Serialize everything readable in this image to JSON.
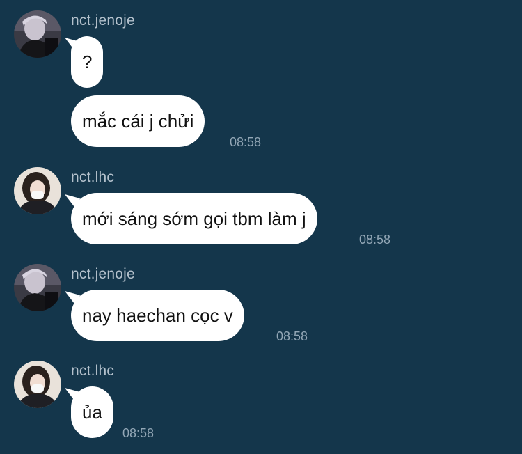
{
  "colors": {
    "background": "#14364b",
    "bubble": "#ffffff",
    "name_text": "#b4c1cc",
    "time_text": "#93a7b6"
  },
  "messages": [
    {
      "sender": "nct.jenoje",
      "text": "?",
      "time": ""
    },
    {
      "sender": "",
      "text": "mắc cái j chửi",
      "time": "08:58"
    },
    {
      "sender": "nct.lhc",
      "text": "mới sáng sớm gọi tbm làm j",
      "time": "08:58"
    },
    {
      "sender": "nct.jenoje",
      "text": "nay haechan cọc v",
      "time": "08:58"
    },
    {
      "sender": "nct.lhc",
      "text": "ủa",
      "time": "08:58"
    }
  ]
}
